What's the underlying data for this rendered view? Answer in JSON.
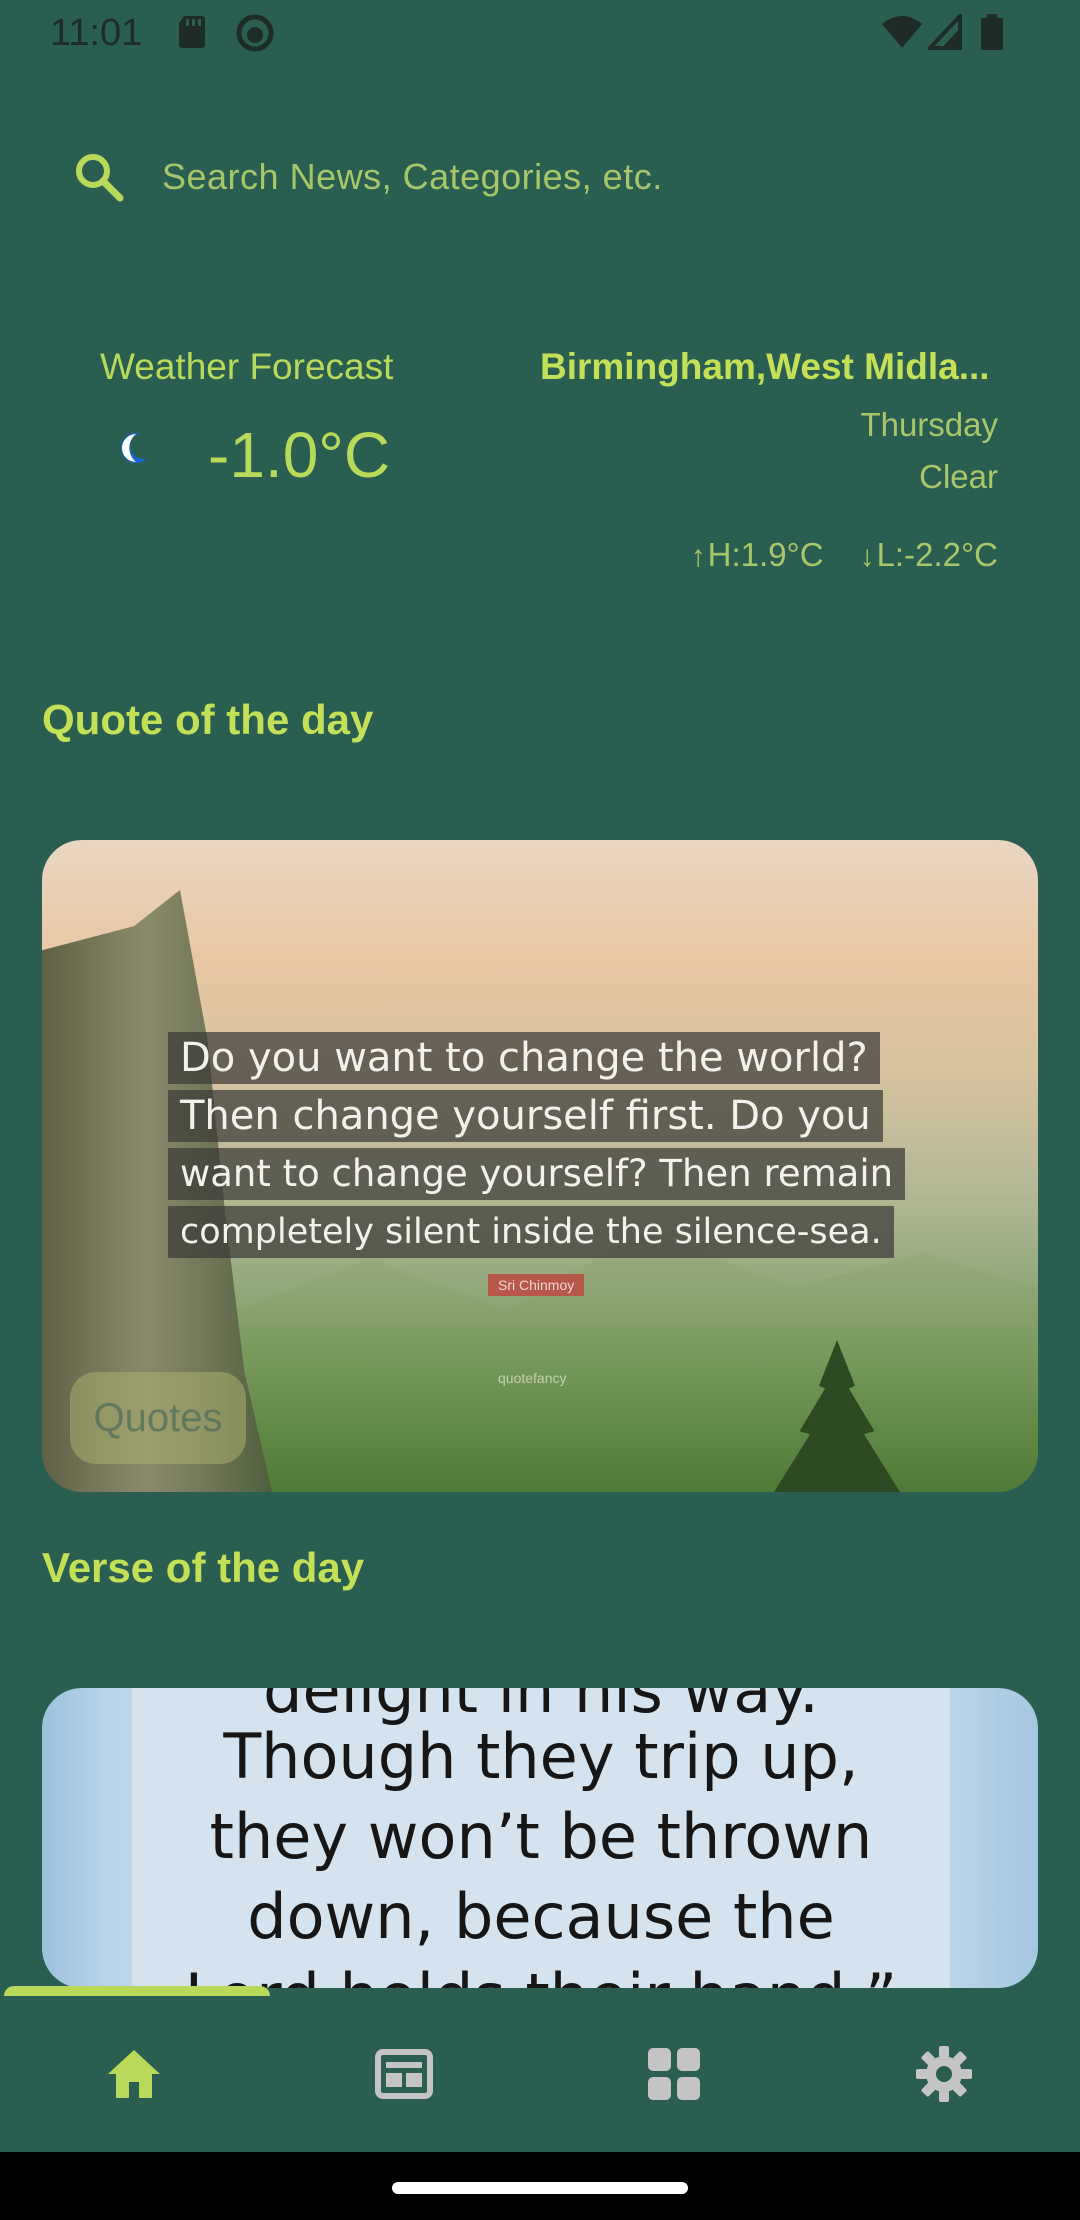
{
  "status_bar": {
    "time": "11:01"
  },
  "search": {
    "placeholder": "Search News, Categories, etc."
  },
  "weather": {
    "title": "Weather Forecast",
    "temperature": "-1.0°C",
    "location": "Birmingham,West Midla...",
    "day": "Thursday",
    "condition": "Clear",
    "high": "H:1.9°C",
    "low": "L:-2.2°C"
  },
  "quote_section": {
    "title": "Quote of the day",
    "lines": [
      "Do you want to change the world?",
      "Then change yourself first. Do you",
      "want to change yourself? Then remain",
      "completely silent inside the silence-sea."
    ],
    "author": "Sri Chinmoy",
    "watermark": "quotefancy",
    "chip_label": "Quotes"
  },
  "verse_section": {
    "title": "Verse of the day",
    "lines": [
      "delight in his way.",
      "Though they trip up,",
      "they won’t be thrown",
      "down, because the",
      "Lord holds their hand.”"
    ]
  },
  "bottom_nav": {
    "items": [
      {
        "name": "home",
        "icon": "home-icon",
        "active": true
      },
      {
        "name": "news",
        "icon": "news-icon",
        "active": false
      },
      {
        "name": "categories",
        "icon": "grid-icon",
        "active": false
      },
      {
        "name": "settings",
        "icon": "gear-icon",
        "active": false
      }
    ],
    "active_color": "#b8d95a",
    "inactive_color": "#c4c4c4"
  },
  "colors": {
    "background": "#2a5e51",
    "accent": "#b8d95a"
  }
}
